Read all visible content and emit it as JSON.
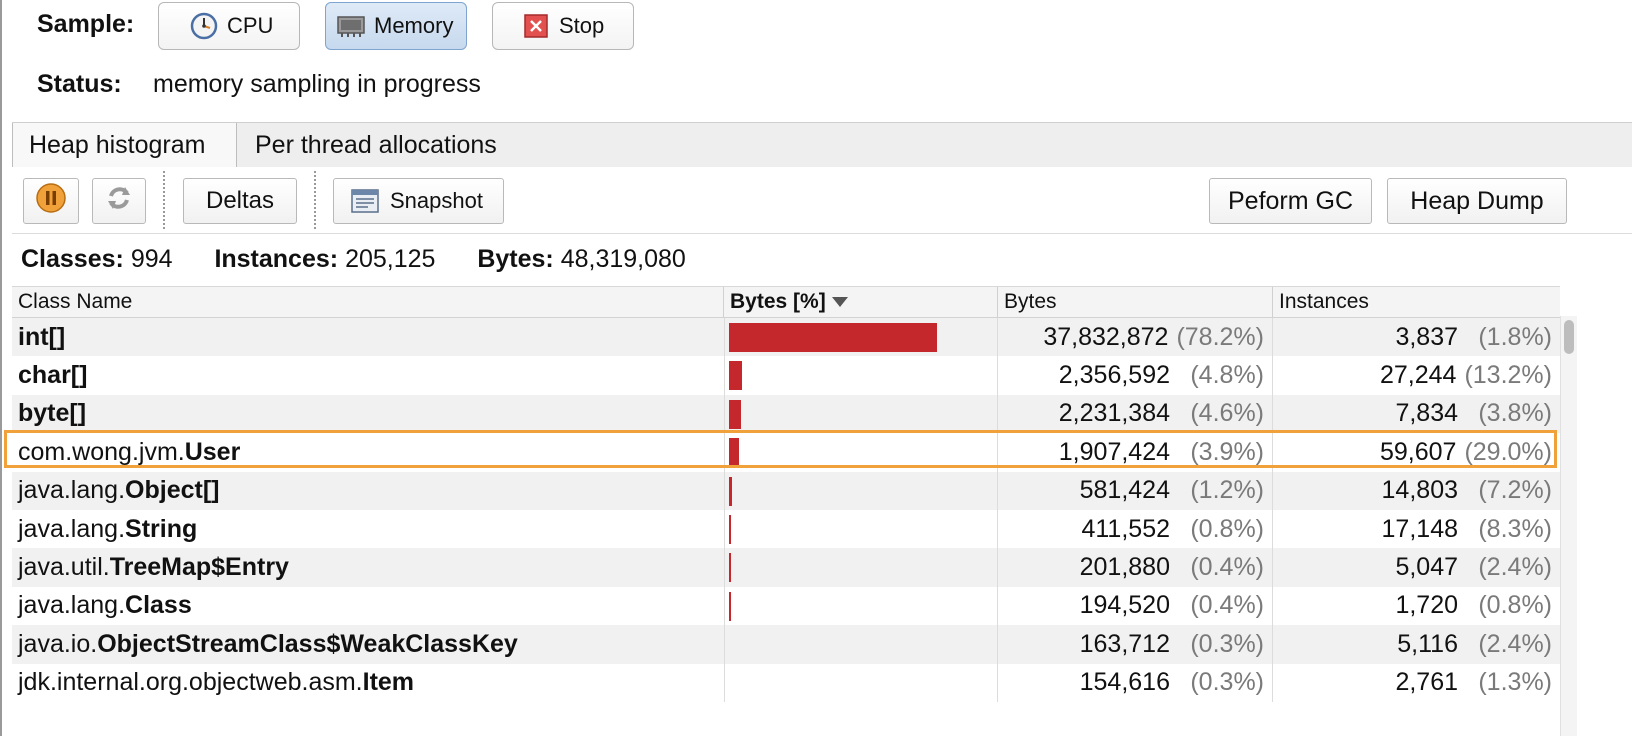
{
  "sample": {
    "label": "Sample:",
    "buttons": [
      {
        "label": "CPU",
        "icon": "clock-icon"
      },
      {
        "label": "Memory",
        "icon": "memory-chip-icon",
        "selected": true
      },
      {
        "label": "Stop",
        "icon": "stop-icon"
      }
    ]
  },
  "status": {
    "label": "Status:",
    "text": "memory sampling in progress"
  },
  "tabs": [
    {
      "label": "Heap histogram",
      "active": true
    },
    {
      "label": "Per thread allocations",
      "active": false
    }
  ],
  "toolbar": {
    "pause_icon": "pause-icon",
    "refresh_icon": "refresh-icon",
    "deltas_label": "Deltas",
    "snapshot_label": "Snapshot",
    "snapshot_icon": "snapshot-icon",
    "gc_label": "Peform GC",
    "heapdump_label": "Heap Dump"
  },
  "summary": {
    "classes_label": "Classes:",
    "classes_value": "994",
    "instances_label": "Instances:",
    "instances_value": "205,125",
    "bytes_label": "Bytes:",
    "bytes_value": "48,319,080"
  },
  "table": {
    "columns": {
      "name": "Class Name",
      "pct": "Bytes [%]",
      "bytes": "Bytes",
      "instances": "Instances"
    },
    "bar_color": "#c4272c",
    "highlight_color": "#f0a13a",
    "rows": [
      {
        "pkg": "",
        "cls": "int[]",
        "bytes": "37,832,872",
        "bytes_pct": "(78.2%)",
        "instances": "3,837",
        "inst_pct": "(1.8%)",
        "share": 78.2
      },
      {
        "pkg": "",
        "cls": "char[]",
        "bytes": "2,356,592",
        "bytes_pct": "(4.8%)",
        "instances": "27,244",
        "inst_pct": "(13.2%)",
        "share": 4.8
      },
      {
        "pkg": "",
        "cls": "byte[]",
        "bytes": "2,231,384",
        "bytes_pct": "(4.6%)",
        "instances": "7,834",
        "inst_pct": "(3.8%)",
        "share": 4.6
      },
      {
        "pkg": "com.wong.jvm.",
        "cls": "User",
        "bytes": "1,907,424",
        "bytes_pct": "(3.9%)",
        "instances": "59,607",
        "inst_pct": "(29.0%)",
        "share": 3.9,
        "highlighted": true
      },
      {
        "pkg": "java.lang.",
        "cls": "Object[]",
        "bytes": "581,424",
        "bytes_pct": "(1.2%)",
        "instances": "14,803",
        "inst_pct": "(7.2%)",
        "share": 1.2
      },
      {
        "pkg": "java.lang.",
        "cls": "String",
        "bytes": "411,552",
        "bytes_pct": "(0.8%)",
        "instances": "17,148",
        "inst_pct": "(8.3%)",
        "share": 0.8
      },
      {
        "pkg": "java.util.",
        "cls": "TreeMap$Entry",
        "bytes": "201,880",
        "bytes_pct": "(0.4%)",
        "instances": "5,047",
        "inst_pct": "(2.4%)",
        "share": 0.4
      },
      {
        "pkg": "java.lang.",
        "cls": "Class",
        "bytes": "194,520",
        "bytes_pct": "(0.4%)",
        "instances": "1,720",
        "inst_pct": "(0.8%)",
        "share": 0.4
      },
      {
        "pkg": "java.io.",
        "cls": "ObjectStreamClass$WeakClassKey",
        "bytes": "163,712",
        "bytes_pct": "(0.3%)",
        "instances": "5,116",
        "inst_pct": "(2.4%)",
        "share": 0.3
      },
      {
        "pkg": "jdk.internal.org.objectweb.asm.",
        "cls": "Item",
        "bytes": "154,616",
        "bytes_pct": "(0.3%)",
        "instances": "2,761",
        "inst_pct": "(1.3%)",
        "share": 0.3
      }
    ]
  }
}
